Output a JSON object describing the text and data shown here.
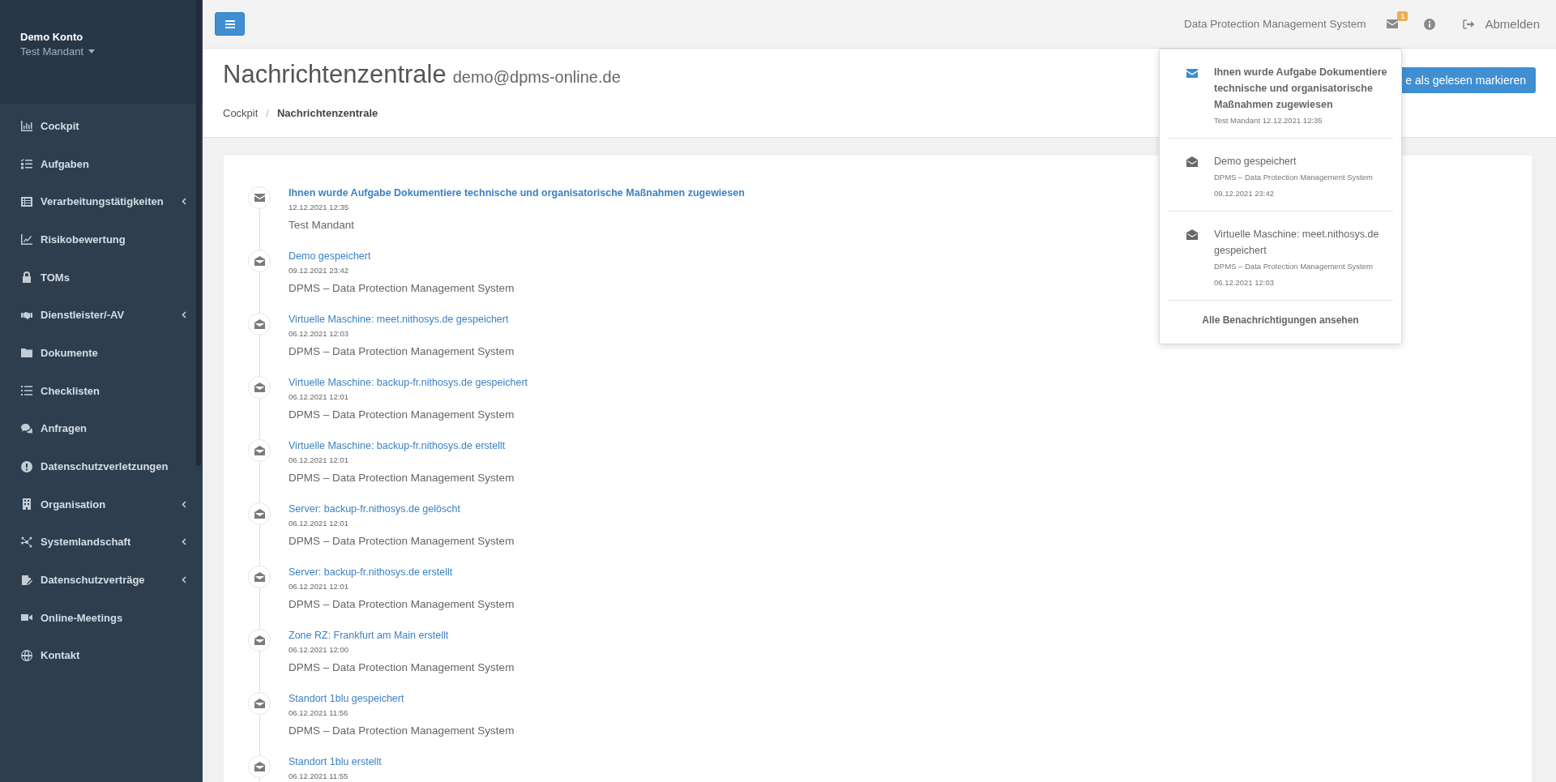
{
  "account": {
    "name": "Demo Konto",
    "tenant": "Test Mandant"
  },
  "sidebar": {
    "items": [
      {
        "label": "Cockpit",
        "has_submenu": false
      },
      {
        "label": "Aufgaben",
        "has_submenu": false
      },
      {
        "label": "Verarbeitungstätigkeiten",
        "has_submenu": true
      },
      {
        "label": "Risikobewertung",
        "has_submenu": false
      },
      {
        "label": "TOMs",
        "has_submenu": false
      },
      {
        "label": "Dienstleister/-AV",
        "has_submenu": true
      },
      {
        "label": "Dokumente",
        "has_submenu": false
      },
      {
        "label": "Checklisten",
        "has_submenu": false
      },
      {
        "label": "Anfragen",
        "has_submenu": false
      },
      {
        "label": "Datenschutzverletzungen",
        "has_submenu": false
      },
      {
        "label": "Organisation",
        "has_submenu": true
      },
      {
        "label": "Systemlandschaft",
        "has_submenu": true
      },
      {
        "label": "Datenschutzverträge",
        "has_submenu": true
      },
      {
        "label": "Online-Meetings",
        "has_submenu": false
      },
      {
        "label": "Kontakt",
        "has_submenu": false
      }
    ]
  },
  "topbar": {
    "system_name": "Data Protection Management System",
    "unread_count": "1",
    "logout": "Abmelden"
  },
  "page": {
    "title": "Nachrichtenzentrale",
    "subtitle": "demo@dpms-online.de",
    "breadcrumb": [
      {
        "label": "Cockpit",
        "current": false
      },
      {
        "label": "Nachrichtenzentrale",
        "current": true
      }
    ],
    "breadcrumb_separator": "/",
    "mark_all_button": "e als gelesen markieren"
  },
  "timeline": [
    {
      "title": "Ihnen wurde Aufgabe Dokumentiere technische und organisatorische Maßnahmen zugewiesen",
      "time": "12.12.2021 12:35",
      "source": "Test Mandant",
      "read": false
    },
    {
      "title": "Demo gespeichert",
      "time": "09.12.2021 23:42",
      "source": "DPMS – Data Protection Management System",
      "read": true
    },
    {
      "title": "Virtuelle Maschine: meet.nithosys.de gespeichert",
      "time": "06.12.2021 12:03",
      "source": "DPMS – Data Protection Management System",
      "read": true
    },
    {
      "title": "Virtuelle Maschine: backup-fr.nithosys.de gespeichert",
      "time": "06.12.2021 12:01",
      "source": "DPMS – Data Protection Management System",
      "read": true
    },
    {
      "title": "Virtuelle Maschine: backup-fr.nithosys.de erstellt",
      "time": "06.12.2021 12:01",
      "source": "DPMS – Data Protection Management System",
      "read": true
    },
    {
      "title": "Server: backup-fr.nithosys.de gelöscht",
      "time": "06.12.2021 12:01",
      "source": "DPMS – Data Protection Management System",
      "read": true
    },
    {
      "title": "Server: backup-fr.nithosys.de erstellt",
      "time": "06.12.2021 12:01",
      "source": "DPMS – Data Protection Management System",
      "read": true
    },
    {
      "title": "Zone RZ: Frankfurt am Main erstellt",
      "time": "06.12.2021 12:00",
      "source": "DPMS – Data Protection Management System",
      "read": true
    },
    {
      "title": "Standort 1blu gespeichert",
      "time": "06.12.2021 11:56",
      "source": "DPMS – Data Protection Management System",
      "read": true
    },
    {
      "title": "Standort 1blu erstellt",
      "time": "06.12.2021 11:55",
      "read": true
    }
  ],
  "notifications": {
    "items": [
      {
        "title": "Ihnen wurde Aufgabe Dokumentiere technische und organisatorische Maßnahmen zugewiesen",
        "lines": [
          "Test Mandant 12.12.2021 12:35"
        ],
        "read": false
      },
      {
        "title": "Demo gespeichert",
        "lines": [
          "DPMS – Data Protection Management System",
          "09.12.2021 23:42"
        ],
        "read": true
      },
      {
        "title": "Virtuelle Maschine: meet.nithosys.de gespeichert",
        "lines": [
          "DPMS – Data Protection Management System",
          "06.12.2021 12:03"
        ],
        "read": true
      }
    ],
    "view_all": "Alle Benachrichtigungen ansehen"
  }
}
